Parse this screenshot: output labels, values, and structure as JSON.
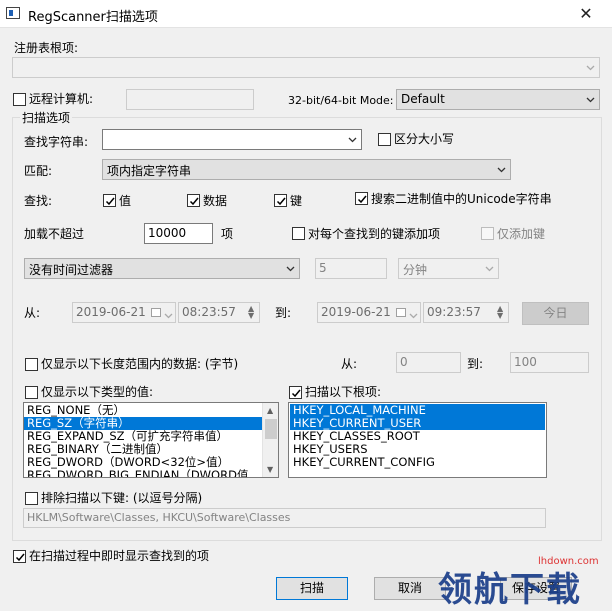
{
  "window": {
    "title": "RegScanner扫描选项",
    "close_glyph": "✕"
  },
  "root_key": {
    "label": "注册表根项:",
    "value": ""
  },
  "remote": {
    "label": "远程计算机:",
    "value": "",
    "checked": false
  },
  "mode": {
    "label": "32-bit/64-bit Mode:",
    "value": "Default"
  },
  "scan_options": {
    "group_title": "扫描选项",
    "find_string_label": "查找字符串:",
    "find_string_value": "",
    "case_sensitive_label": "区分大小写",
    "match_label": "匹配:",
    "match_value": "项内指定字符串",
    "find_label": "查找:",
    "find_values_label": "值",
    "find_data_label": "数据",
    "find_keys_label": "键",
    "unicode_label": "搜索二进制值中的Unicode字符串",
    "load_limit_label": "加载不超过",
    "load_limit_value": "10000",
    "load_limit_unit": "项",
    "add_key_label": "对每个查找到的键添加项",
    "only_add_key_label": "仅添加键",
    "time_filter_value": "没有时间过滤器",
    "time_amount_value": "5",
    "time_unit_value": "分钟",
    "from_label": "从:",
    "from_date": "2019-06-21",
    "from_time": "08:23:57",
    "to_label": "到:",
    "to_date": "2019-06-21",
    "to_time": "09:23:57",
    "today_label": "今日",
    "length_range_label": "仅显示以下长度范围内的数据: (字节)",
    "length_from_label": "从:",
    "length_from_value": "0",
    "length_to_label": "到:",
    "length_to_value": "100",
    "types_label": "仅显示以下类型的值:",
    "types": [
      {
        "text": "REG_NONE（无）",
        "selected": false
      },
      {
        "text": "REG_SZ（字符串）",
        "selected": true
      },
      {
        "text": "REG_EXPAND_SZ（可扩充字符串值）",
        "selected": false
      },
      {
        "text": "REG_BINARY（二进制值）",
        "selected": false
      },
      {
        "text": "REG_DWORD（DWORD<32位>值）",
        "selected": false
      },
      {
        "text": "REG_DWORD_BIG_ENDIAN（DWORD值",
        "selected": false
      }
    ],
    "roots_label": "扫描以下根项:",
    "roots": [
      {
        "text": "HKEY_LOCAL_MACHINE",
        "selected": true
      },
      {
        "text": "HKEY_CURRENT_USER",
        "selected": true
      },
      {
        "text": "HKEY_CLASSES_ROOT",
        "selected": false
      },
      {
        "text": "HKEY_USERS",
        "selected": false
      },
      {
        "text": "HKEY_CURRENT_CONFIG",
        "selected": false
      }
    ],
    "exclude_label": "排除扫描以下键: (以逗号分隔)",
    "exclude_value": "HKLM\\Software\\Classes, HKCU\\Software\\Classes"
  },
  "show_during_scan_label": "在扫描过程中即时显示查找到的项",
  "buttons": {
    "scan": "扫描",
    "cancel": "取消",
    "save": "保存设置"
  },
  "watermark": {
    "logo_text": "领航下载",
    "url": "lhdown.com"
  },
  "colors": {
    "selection": "#0078d7",
    "dialog_bg": "#f0f0f0"
  }
}
